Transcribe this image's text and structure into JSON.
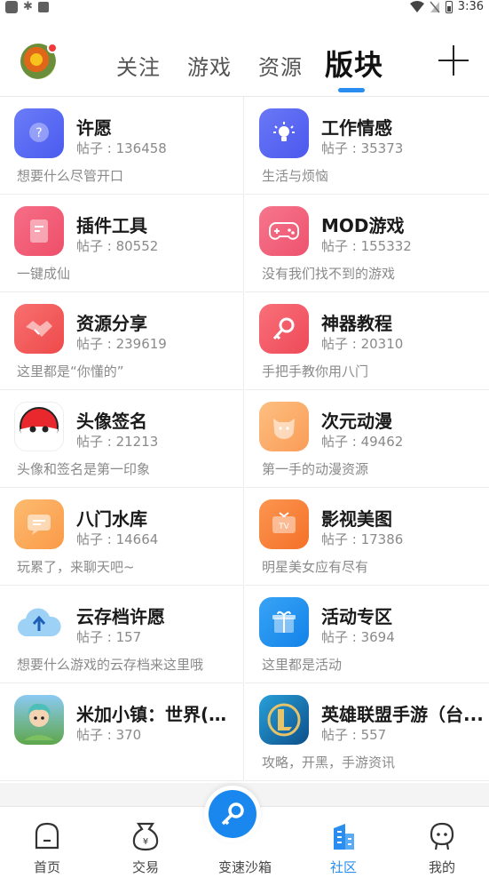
{
  "status_bar": {
    "time": "3:36"
  },
  "header": {
    "tabs": [
      {
        "label": "关注"
      },
      {
        "label": "游戏"
      },
      {
        "label": "资源"
      },
      {
        "label": "版块"
      }
    ]
  },
  "boards": [
    {
      "name": "许愿",
      "posts": "帖子 : 136458",
      "desc": "想要什么尽管开口",
      "icon": "question-bubble-icon",
      "color": "#5b6cf6"
    },
    {
      "name": "工作情感",
      "posts": "帖子 : 35373",
      "desc": "生活与烦恼",
      "icon": "lightbulb-icon",
      "color": "#5a66f2"
    },
    {
      "name": "插件工具",
      "posts": "帖子 : 80552",
      "desc": "一键成仙",
      "icon": "document-icon",
      "color": "#f05a74"
    },
    {
      "name": "MOD游戏",
      "posts": "帖子 : 155332",
      "desc": "没有我们找不到的游戏",
      "icon": "gamepad-icon",
      "color": "#f0607a"
    },
    {
      "name": "资源分享",
      "posts": "帖子 : 239619",
      "desc": "这里都是“你懂的”",
      "icon": "handshake-icon",
      "color": "#f25a5a"
    },
    {
      "name": "神器教程",
      "posts": "帖子 : 20310",
      "desc": "手把手教你用八门",
      "icon": "key-icon",
      "color": "#f05a64"
    },
    {
      "name": "头像签名",
      "posts": "帖子 : 21213",
      "desc": "头像和签名是第一印象",
      "icon": "pokeball-face-icon",
      "color": "#ffffff"
    },
    {
      "name": "次元动漫",
      "posts": "帖子 : 49462",
      "desc": "第一手的动漫资源",
      "icon": "cat-face-icon",
      "color": "#fcae6a"
    },
    {
      "name": "八门水库",
      "posts": "帖子 : 14664",
      "desc": "玩累了，来聊天吧~",
      "icon": "chat-icon",
      "color": "#fca860"
    },
    {
      "name": "影视美图",
      "posts": "帖子 : 17386",
      "desc": "明星美女应有尽有",
      "icon": "tv-icon",
      "color": "#f8823c"
    },
    {
      "name": "云存档许愿",
      "posts": "帖子 : 157",
      "desc": "想要什么游戏的云存档来这里哦",
      "icon": "cloud-upload-icon",
      "color": "#ffffff"
    },
    {
      "name": "活动专区",
      "posts": "帖子 : 3694",
      "desc": "这里都是活动",
      "icon": "gift-icon",
      "color": "#1c8ef0"
    },
    {
      "name": "米加小镇：世界(新...",
      "posts": "帖子 : 370",
      "desc": "",
      "icon": "game-app-icon",
      "color": "#6db4e8"
    },
    {
      "name": "英雄联盟手游（台...",
      "posts": "帖子 : 557",
      "desc": "攻略，开黑，手游资讯",
      "icon": "lol-app-icon",
      "color": "#1a6aa8"
    }
  ],
  "bottom_nav": [
    {
      "label": "首页",
      "icon": "home-icon"
    },
    {
      "label": "交易",
      "icon": "money-bag-icon"
    },
    {
      "label": "变速沙箱",
      "icon": "speed-key-icon"
    },
    {
      "label": "社区",
      "icon": "community-building-icon"
    },
    {
      "label": "我的",
      "icon": "profile-icon"
    }
  ],
  "colors": {
    "accent": "#2a8ef0",
    "text_primary": "#1a1a1a",
    "text_secondary": "#8a8a8a"
  }
}
